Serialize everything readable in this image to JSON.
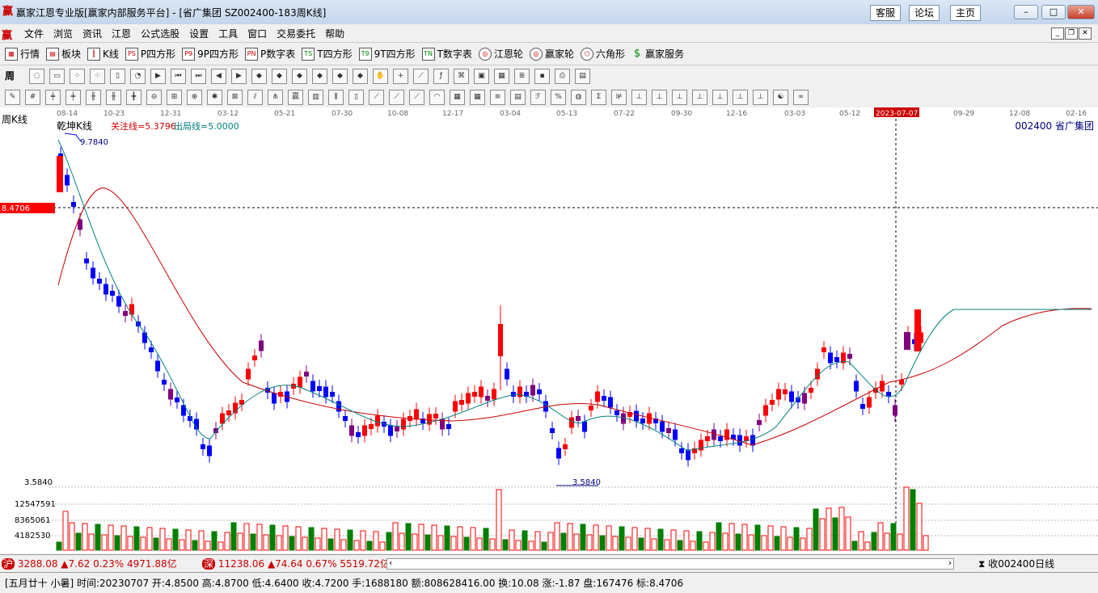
{
  "window": {
    "title": "赢家江恩专业版[赢家内部服务平台] - [省广集团  SZ002400-183周K线]",
    "links": [
      "客服",
      "论坛",
      "主页"
    ],
    "controls": [
      "minimize",
      "maximize",
      "close"
    ]
  },
  "menu": {
    "items": [
      "文件",
      "浏览",
      "资讯",
      "江恩",
      "公式选股",
      "设置",
      "工具",
      "窗口",
      "交易委托",
      "帮助"
    ]
  },
  "toolbar1": {
    "items": [
      {
        "label": "行情",
        "icon": "grid-icon"
      },
      {
        "label": "板块",
        "icon": "blocks-icon"
      },
      {
        "label": "K线",
        "icon": "kline-icon"
      },
      {
        "label": "P四方形",
        "icon": "ps-icon"
      },
      {
        "label": "9P四方形",
        "icon": "p9-icon"
      },
      {
        "label": "P数字表",
        "icon": "pn-icon"
      },
      {
        "label": "T四方形",
        "icon": "ts-icon"
      },
      {
        "label": "9T四方形",
        "icon": "t9-icon"
      },
      {
        "label": "T数字表",
        "icon": "tn-icon"
      },
      {
        "label": "江恩轮",
        "icon": "wheel-icon"
      },
      {
        "label": "赢家轮",
        "icon": "wheel2-icon"
      },
      {
        "label": "六角形",
        "icon": "hexagon-icon"
      },
      {
        "label": "赢家服务",
        "icon": "dollar-icon"
      }
    ]
  },
  "period_select": "周",
  "chart": {
    "period_label": "周K线",
    "indicator_name": "乾坤K线",
    "guanzhu": "关注线=5.3796",
    "chuju": "出局线=5.0000",
    "code_name": "002400  省广集团",
    "high_label": "9.7840",
    "low_label": "3.5840",
    "cursor_price": "8.4706",
    "cursor_date": "2023-07-07",
    "axis_low": "3.5840",
    "dates": [
      "08-14",
      "10-23",
      "12-31",
      "03-12",
      "05-21",
      "07-30",
      "10-08",
      "12-17",
      "03-04",
      "05-13",
      "07-22",
      "09-30",
      "12-16",
      "03-03",
      "05-12",
      "2023-07-07",
      "09-29",
      "12-08",
      "02-16"
    ],
    "vol_ticks": [
      "12547591",
      "8365061",
      "4182530"
    ]
  },
  "indexes": [
    {
      "name": "沪",
      "value": "3288.08",
      "change": "▲7.62",
      "pct": "0.23%",
      "amount": "4971.88亿"
    },
    {
      "name": "深",
      "value": "11238.06",
      "change": "▲74.64",
      "pct": "0.67%",
      "amount": "5519.72亿"
    }
  ],
  "daily_link": "收002400日线",
  "status": "[五月廿十 小暑] 时间:20230707 开:4.8500 高:4.8700 低:4.6400 收:4.7200 手:1688180 额:808628416.00 换:10.08 涨:-1.87 盘:167476 标:8.4706",
  "colors": {
    "up": "#ff0000",
    "down": "#0000ff",
    "purple": "#800080",
    "vol_up": "#ff0000",
    "vol_down": "#008000"
  }
}
